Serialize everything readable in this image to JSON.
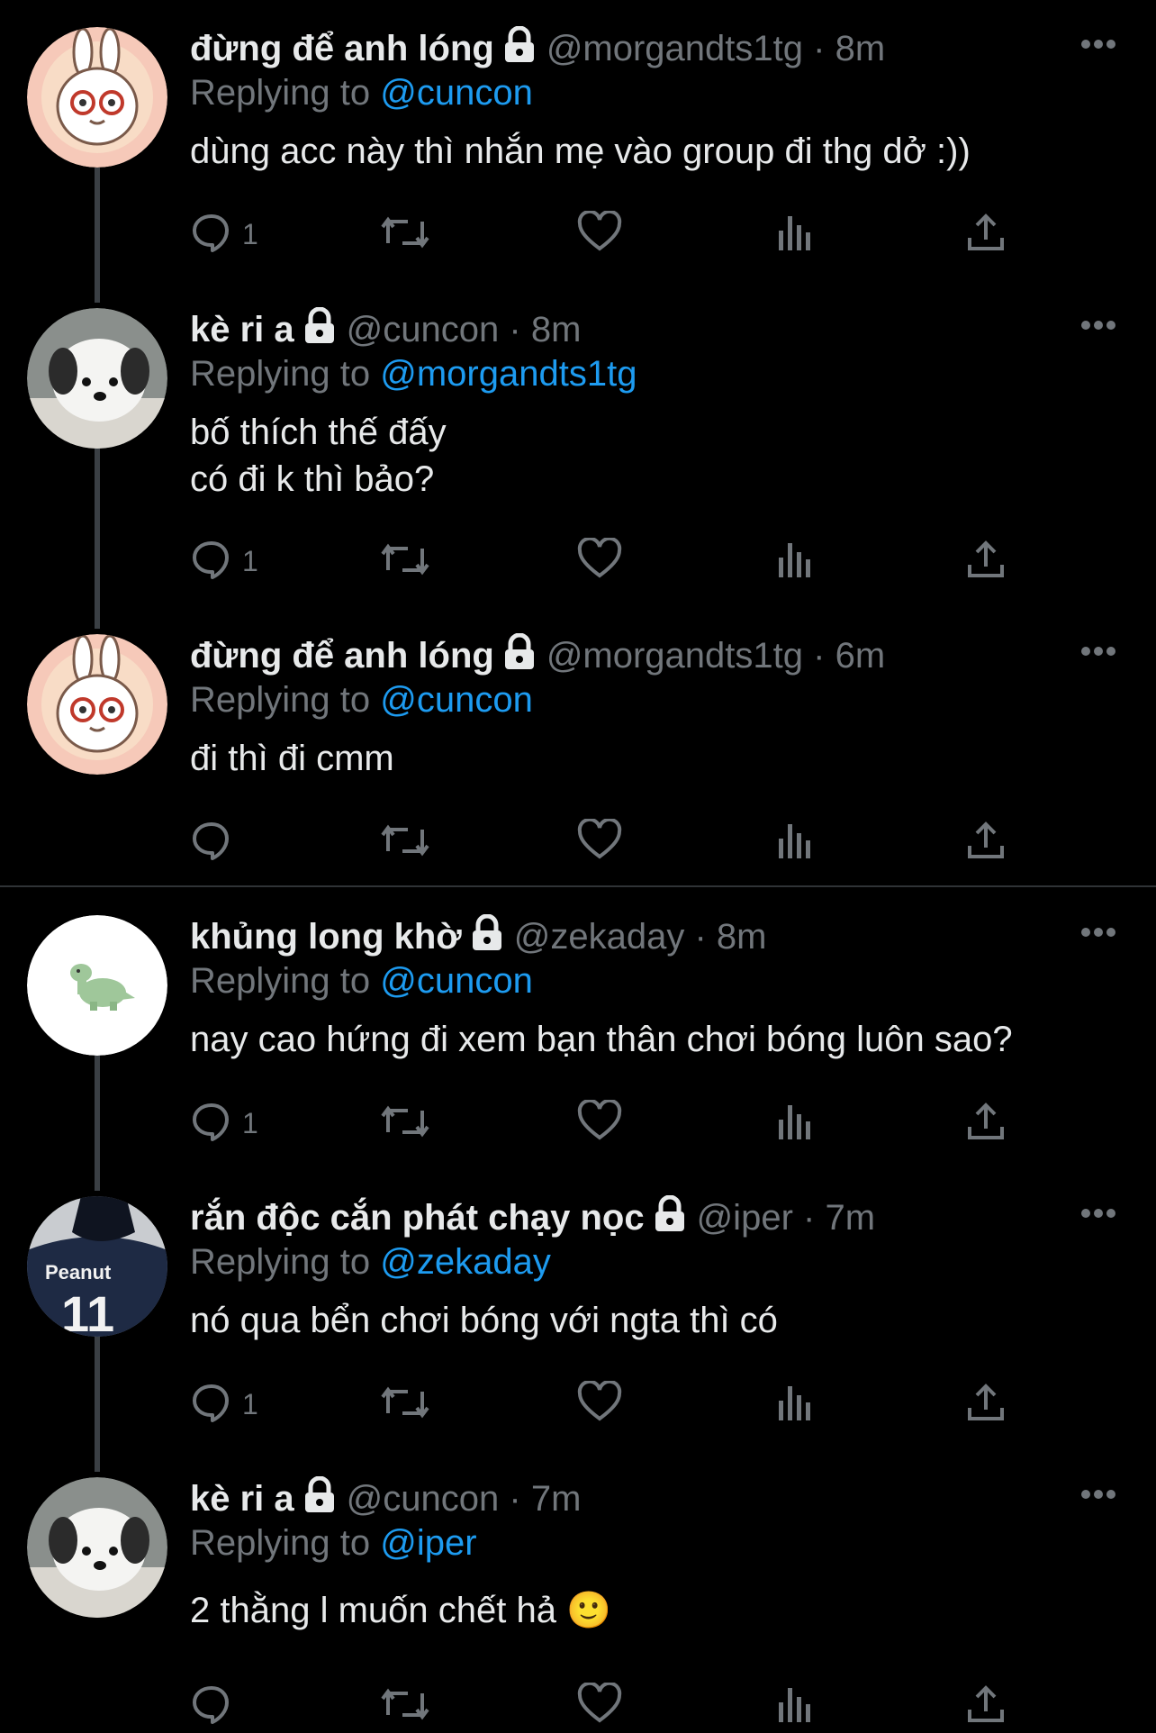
{
  "tweets": [
    {
      "name": "đừng để anh lóng",
      "handle": "@morgandts1tg",
      "dot": "·",
      "time": "8m",
      "reply_prefix": "Replying to",
      "reply_to": "@cuncon",
      "content": "dùng acc này thì nhắn mẹ vào group đi thg dở :))",
      "reply_count": "1",
      "avatar_icon": "bunny-avatar"
    },
    {
      "name": "kè ri a",
      "handle": "@cuncon",
      "dot": "·",
      "time": "8m",
      "reply_prefix": "Replying to",
      "reply_to": "@morgandts1tg",
      "content": "bố thích thế đấy\ncó đi k thì bảo?",
      "reply_count": "1",
      "avatar_icon": "plush-dog-avatar"
    },
    {
      "name": "đừng để anh lóng",
      "handle": "@morgandts1tg",
      "dot": "·",
      "time": "6m",
      "reply_prefix": "Replying to",
      "reply_to": "@cuncon",
      "content": "đi thì đi cmm",
      "reply_count": "",
      "avatar_icon": "bunny-avatar"
    },
    {
      "name": "khủng long khờ",
      "handle": "@zekaday",
      "dot": "·",
      "time": "8m",
      "reply_prefix": "Replying to",
      "reply_to": "@cuncon",
      "content": "nay cao hứng đi xem bạn thân chơi bóng luôn sao?",
      "reply_count": "1",
      "avatar_icon": "dinosaur-avatar"
    },
    {
      "name": "rắn độc cắn phát chạy nọc",
      "handle": "@iper",
      "dot": "·",
      "time": "7m",
      "reply_prefix": "Replying to",
      "reply_to": "@zekaday",
      "content": "nó qua bển chơi bóng với ngta thì có",
      "reply_count": "1",
      "avatar_icon": "jersey-avatar",
      "avatar_text": "Peanut",
      "avatar_number": "11"
    },
    {
      "name": "kè ri a",
      "handle": "@cuncon",
      "dot": "·",
      "time": "7m",
      "reply_prefix": "Replying to",
      "reply_to": "@iper",
      "content": "2 thằng l muốn chết hả 🙂",
      "reply_count": "",
      "avatar_icon": "plush-dog-avatar"
    }
  ],
  "colors": {
    "background": "#000000",
    "text": "#e7e9ea",
    "muted": "#71767b",
    "mention": "#1d9bf0",
    "thread_line": "#3a3f44"
  }
}
